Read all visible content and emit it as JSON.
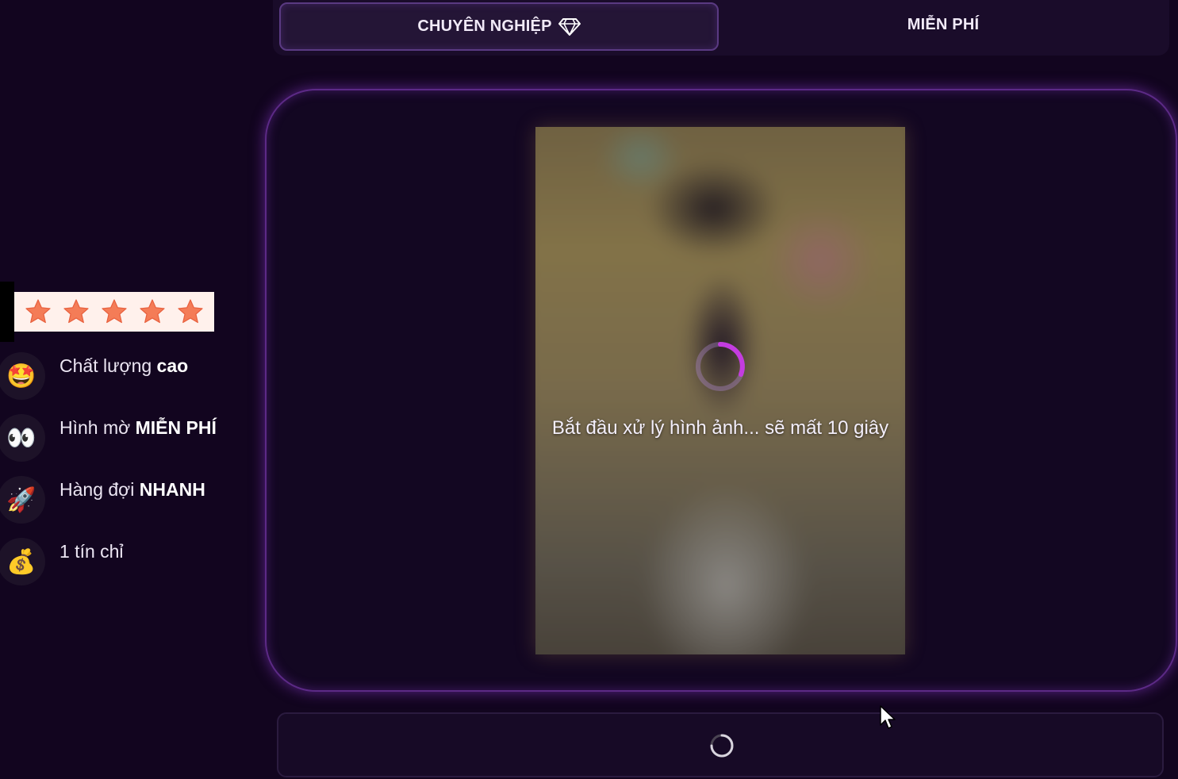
{
  "tabs": {
    "pro_label": "CHUYÊN NGHIỆP",
    "pro_icon": "diamond-icon",
    "free_label": "MIỄN PHÍ"
  },
  "rating": {
    "stars": 5,
    "star_color": "#f47c57",
    "background": "#fff1ec"
  },
  "features": [
    {
      "icon": "star-struck-emoji-icon",
      "emoji": "🤩",
      "text": "Chất lượng ",
      "bold": "cao"
    },
    {
      "icon": "eyes-emoji-icon",
      "emoji": "👀",
      "text": "Hình mờ ",
      "bold": "MIỄN PHÍ"
    },
    {
      "icon": "rocket-emoji-icon",
      "emoji": "🚀",
      "text": "Hàng đợi ",
      "bold": "NHANH"
    },
    {
      "icon": "money-bag-emoji-icon",
      "emoji": "💰",
      "text": "1 tín chỉ",
      "bold": ""
    }
  ],
  "preview": {
    "status_text": "Bắt đầu xử lý hình ảnh... sẽ mất 10 giây",
    "spinner_color": "#c43ce0"
  },
  "colors": {
    "background": "#12051f",
    "card_glow": "#7a2fb5",
    "accent": "#c43ce0"
  }
}
